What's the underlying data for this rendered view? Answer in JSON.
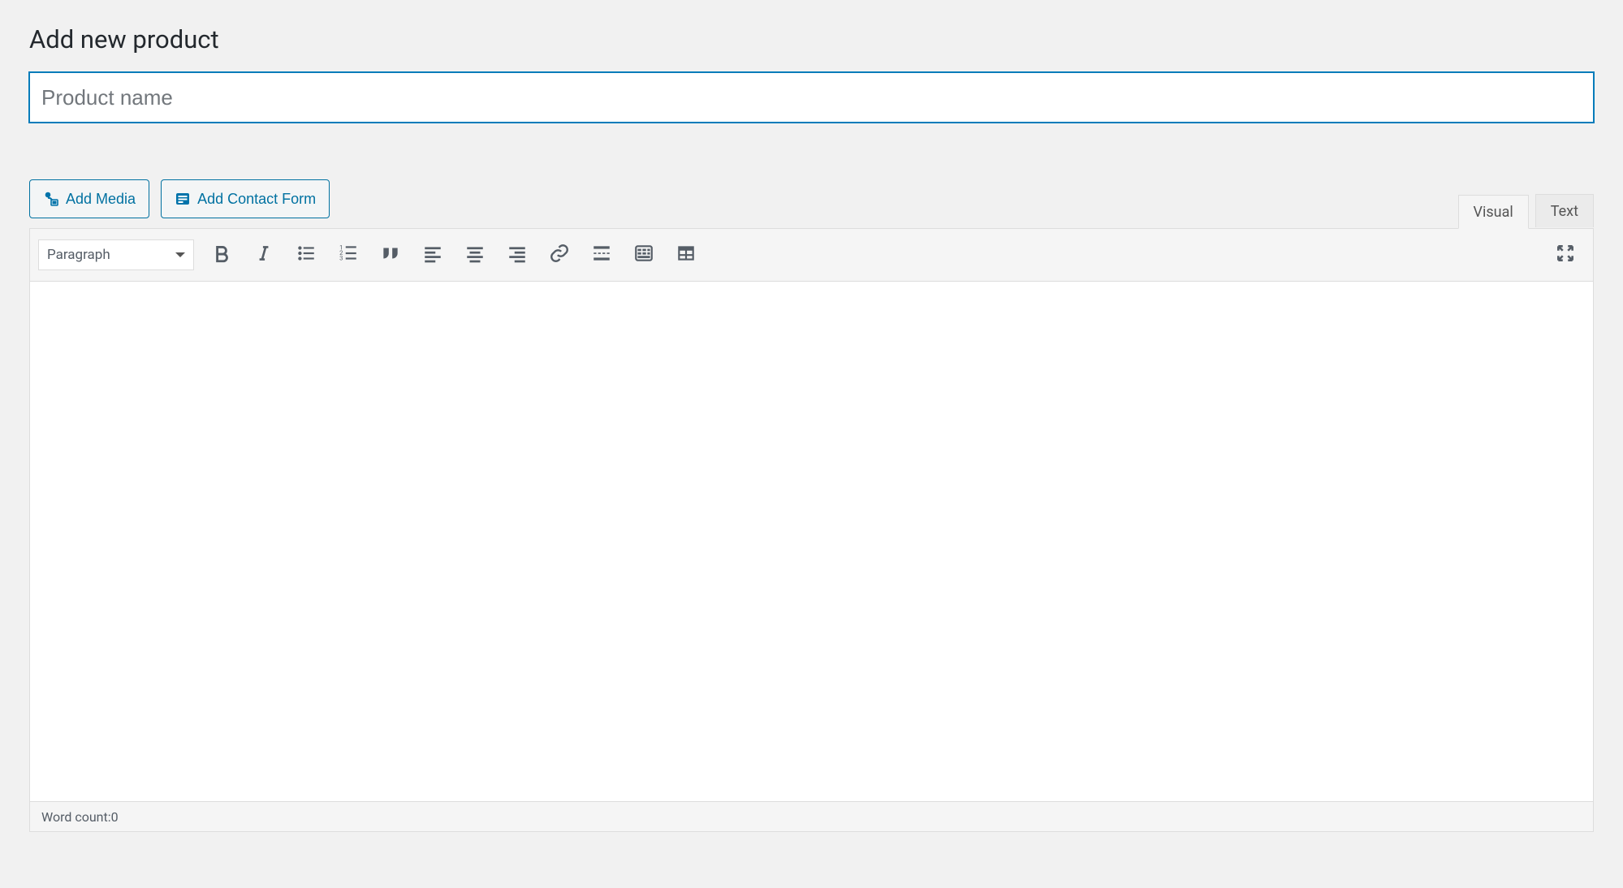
{
  "page": {
    "title": "Add new product"
  },
  "title_input": {
    "value": "",
    "placeholder": "Product name"
  },
  "media_buttons": {
    "add_media": "Add Media",
    "add_contact_form": "Add Contact Form"
  },
  "editor_tabs": {
    "visual": "Visual",
    "text": "Text",
    "active": "visual"
  },
  "toolbar": {
    "format_select": "Paragraph",
    "icons": {
      "bold": "bold-icon",
      "italic": "italic-icon",
      "bullet_list": "bullet-list-icon",
      "numbered_list": "numbered-list-icon",
      "blockquote": "blockquote-icon",
      "align_left": "align-left-icon",
      "align_center": "align-center-icon",
      "align_right": "align-right-icon",
      "link": "link-icon",
      "read_more": "read-more-icon",
      "toolbar_toggle": "toolbar-toggle-icon",
      "table": "table-icon",
      "fullscreen": "fullscreen-icon"
    }
  },
  "editor_content": "",
  "status_bar": {
    "word_count_label": "Word count: ",
    "word_count_value": "0"
  }
}
